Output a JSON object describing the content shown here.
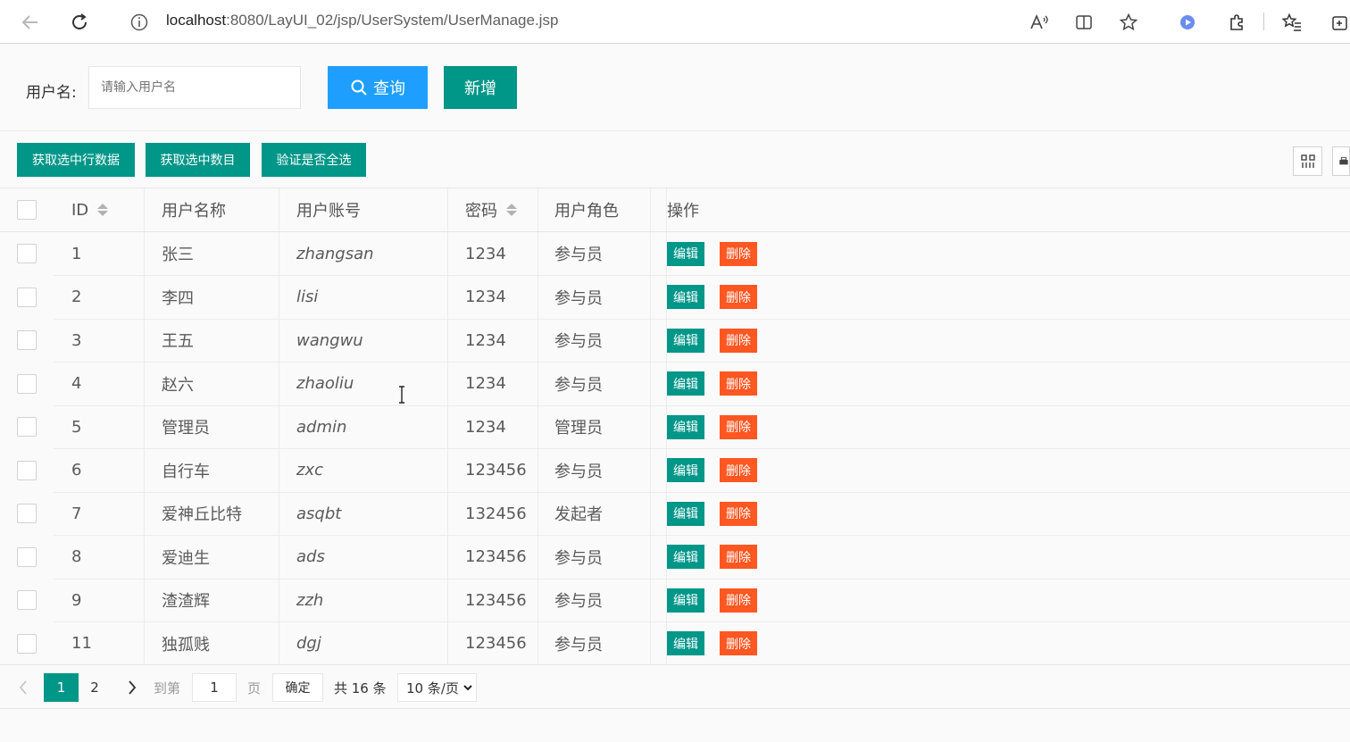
{
  "browser": {
    "url_host": "localhost",
    "url_path": ":8080/LayUI_02/jsp/UserSystem/UserManage.jsp"
  },
  "search": {
    "label": "用户名:",
    "placeholder": "请输入用户名",
    "query_button": "查询",
    "add_button": "新增"
  },
  "toolbar": {
    "get_checked_data": "获取选中行数据",
    "get_checked_count": "获取选中数目",
    "check_all": "验证是否全选"
  },
  "table": {
    "columns": [
      "ID",
      "用户名称",
      "用户账号",
      "密码",
      "用户角色",
      "操作"
    ],
    "edit_label": "编辑",
    "delete_label": "删除",
    "rows": [
      {
        "id": "1",
        "name": "张三",
        "account": "zhangsan",
        "password": "1234",
        "role": "参与员"
      },
      {
        "id": "2",
        "name": "李四",
        "account": "lisi",
        "password": "1234",
        "role": "参与员"
      },
      {
        "id": "3",
        "name": "王五",
        "account": "wangwu",
        "password": "1234",
        "role": "参与员"
      },
      {
        "id": "4",
        "name": "赵六",
        "account": "zhaoliu",
        "password": "1234",
        "role": "参与员"
      },
      {
        "id": "5",
        "name": "管理员",
        "account": "admin",
        "password": "1234",
        "role": "管理员"
      },
      {
        "id": "6",
        "name": "自行车",
        "account": "zxc",
        "password": "123456",
        "role": "参与员"
      },
      {
        "id": "7",
        "name": "爱神丘比特",
        "account": "asqbt",
        "password": "132456",
        "role": "发起者"
      },
      {
        "id": "8",
        "name": "爱迪生",
        "account": "ads",
        "password": "123456",
        "role": "参与员"
      },
      {
        "id": "9",
        "name": "渣渣辉",
        "account": "zzh",
        "password": "123456",
        "role": "参与员"
      },
      {
        "id": "11",
        "name": "独孤贱",
        "account": "dgj",
        "password": "123456",
        "role": "参与员"
      }
    ]
  },
  "pager": {
    "current_page": "1",
    "page_2": "2",
    "goto_label": "到第",
    "goto_value": "1",
    "page_unit": "页",
    "confirm": "确定",
    "total": "共 16 条",
    "page_size": "10 条/页"
  },
  "colors": {
    "primary": "#009688",
    "query": "#1e9fff",
    "danger": "#ff5722"
  }
}
